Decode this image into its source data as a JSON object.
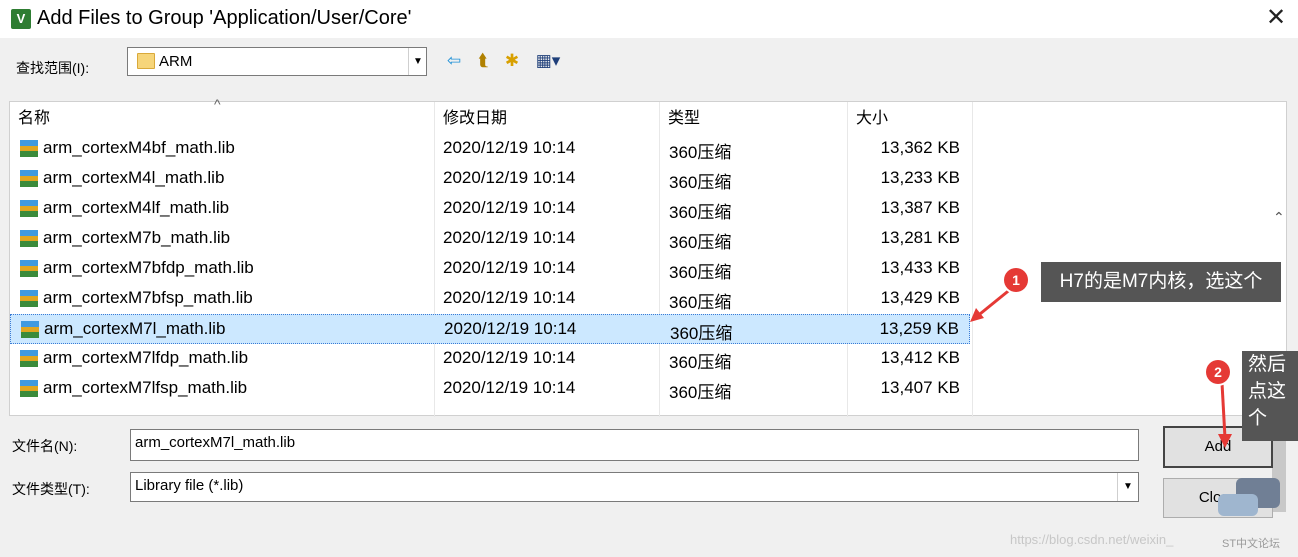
{
  "window": {
    "title": "Add Files to Group 'Application/User/Core'",
    "close_glyph": "✕",
    "icon_text": "V"
  },
  "lookin": {
    "label": "查找范围(I):",
    "value": "ARM",
    "drop": "▼"
  },
  "toolbar": {
    "back": "⇦",
    "up": "⮬",
    "new_folder": "✱",
    "view": "▦▾"
  },
  "columns": {
    "name": "名称",
    "date": "修改日期",
    "type": "类型",
    "size": "大小",
    "sort_arrow": "^"
  },
  "files": [
    {
      "name": "arm_cortexM4bf_math.lib",
      "date": "2020/12/19 10:14",
      "type": "360压缩",
      "size": "13,362 KB"
    },
    {
      "name": "arm_cortexM4l_math.lib",
      "date": "2020/12/19 10:14",
      "type": "360压缩",
      "size": "13,233 KB"
    },
    {
      "name": "arm_cortexM4lf_math.lib",
      "date": "2020/12/19 10:14",
      "type": "360压缩",
      "size": "13,387 KB"
    },
    {
      "name": "arm_cortexM7b_math.lib",
      "date": "2020/12/19 10:14",
      "type": "360压缩",
      "size": "13,281 KB"
    },
    {
      "name": "arm_cortexM7bfdp_math.lib",
      "date": "2020/12/19 10:14",
      "type": "360压缩",
      "size": "13,433 KB"
    },
    {
      "name": "arm_cortexM7bfsp_math.lib",
      "date": "2020/12/19 10:14",
      "type": "360压缩",
      "size": "13,429 KB"
    },
    {
      "name": "arm_cortexM7l_math.lib",
      "date": "2020/12/19 10:14",
      "type": "360压缩",
      "size": "13,259 KB"
    },
    {
      "name": "arm_cortexM7lfdp_math.lib",
      "date": "2020/12/19 10:14",
      "type": "360压缩",
      "size": "13,412 KB"
    },
    {
      "name": "arm_cortexM7lfsp_math.lib",
      "date": "2020/12/19 10:14",
      "type": "360压缩",
      "size": "13,407 KB"
    }
  ],
  "selected_index": 6,
  "filename": {
    "label": "文件名(N):",
    "value": "arm_cortexM7l_math.lib"
  },
  "filetype": {
    "label": "文件类型(T):",
    "value": "Library file (*.lib)",
    "drop": "▼"
  },
  "buttons": {
    "add": "Add",
    "close": "Close"
  },
  "annotations": {
    "badge1": "1",
    "note1": "H7的是M7内核，选这个",
    "badge2": "2",
    "note2_lines": [
      "然后",
      "点这",
      "个"
    ]
  },
  "watermark": {
    "url": "https://blog.csdn.net/weixin_",
    "brand": "ST中文论坛"
  },
  "colors": {
    "selection": "#cce8ff",
    "annotation": "#e53935",
    "tooltip": "#555555"
  }
}
